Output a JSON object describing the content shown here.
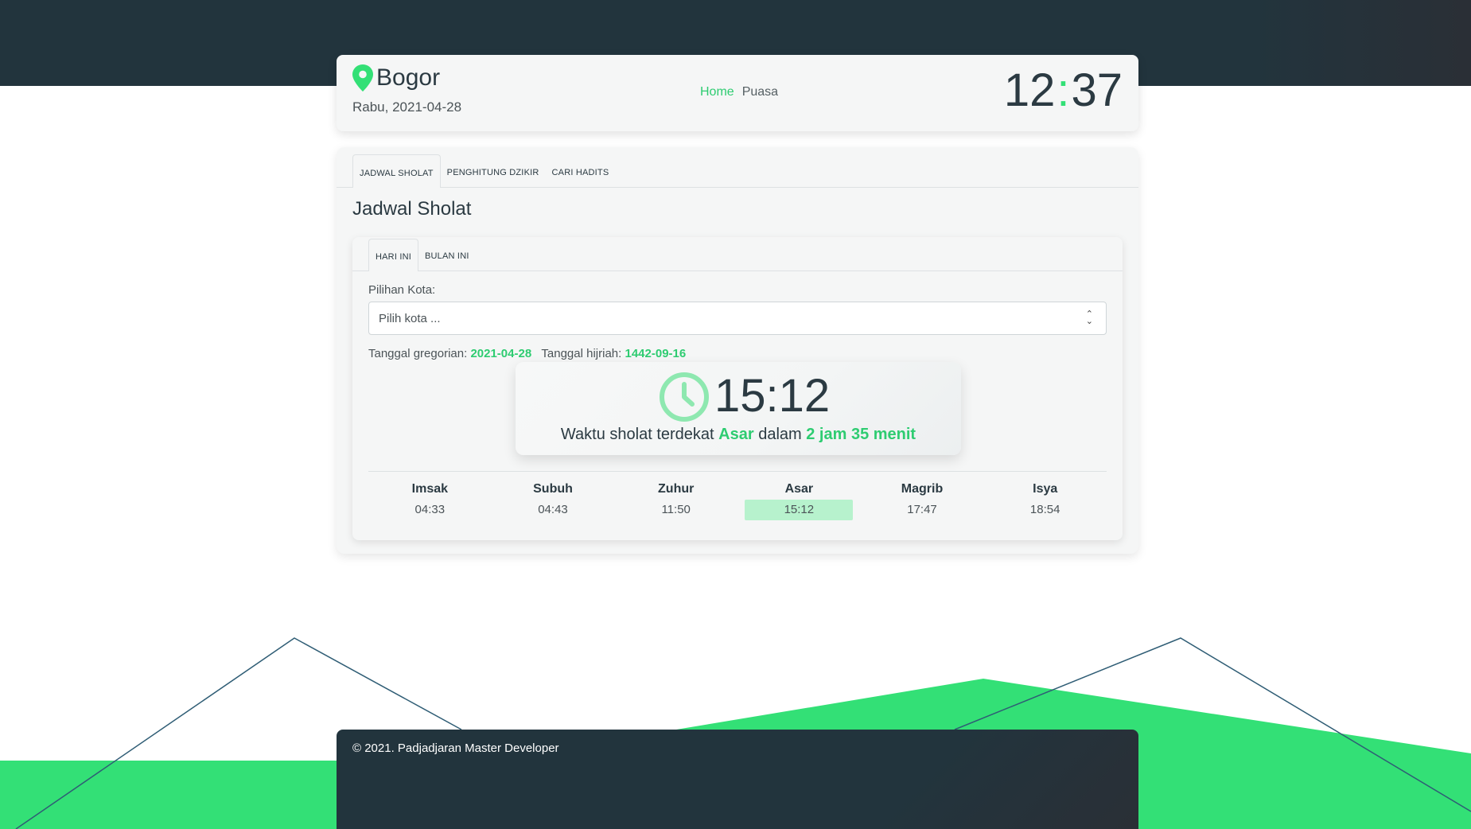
{
  "colors": {
    "accent": "#2ecc71",
    "dark": "#22343d",
    "mountain": "#33e076",
    "highlight": "#b7f2cd"
  },
  "header": {
    "city": "Bogor",
    "date": "Rabu, 2021-04-28",
    "nav": {
      "home": "Home",
      "puasa": "Puasa"
    },
    "clock": {
      "hours": "12",
      "separator": ":",
      "minutes": "37"
    },
    "location_icon": "map-pin-icon"
  },
  "main_tabs": [
    {
      "label": "JADWAL SHOLAT",
      "active": true
    },
    {
      "label": "PENGHITUNG DZIKIR",
      "active": false
    },
    {
      "label": "CARI HADITS",
      "active": false
    }
  ],
  "section_title": "Jadwal Sholat",
  "sub_tabs": [
    {
      "label": "HARI INI",
      "active": true
    },
    {
      "label": "BULAN INI",
      "active": false
    }
  ],
  "city_select": {
    "label": "Pilihan Kota:",
    "placeholder": "Pilih kota ..."
  },
  "dates": {
    "gregorian_label": "Tanggal gregorian:",
    "gregorian_value": "2021-04-28",
    "hijri_label": "Tanggal hijriah:",
    "hijri_value": "1442-09-16"
  },
  "next_prayer": {
    "time": "15:12",
    "text_before": "Waktu sholat terdekat",
    "prayer": "Asar",
    "text_mid": "dalam",
    "countdown": "2 jam 35 menit",
    "icon": "clock-icon"
  },
  "schedule": [
    {
      "name": "Imsak",
      "time": "04:33"
    },
    {
      "name": "Subuh",
      "time": "04:43"
    },
    {
      "name": "Zuhur",
      "time": "11:50"
    },
    {
      "name": "Asar",
      "time": "15:12"
    },
    {
      "name": "Magrib",
      "time": "17:47"
    },
    {
      "name": "Isya",
      "time": "18:54"
    }
  ],
  "footer": {
    "text": "© 2021. Padjadjaran Master Developer"
  }
}
